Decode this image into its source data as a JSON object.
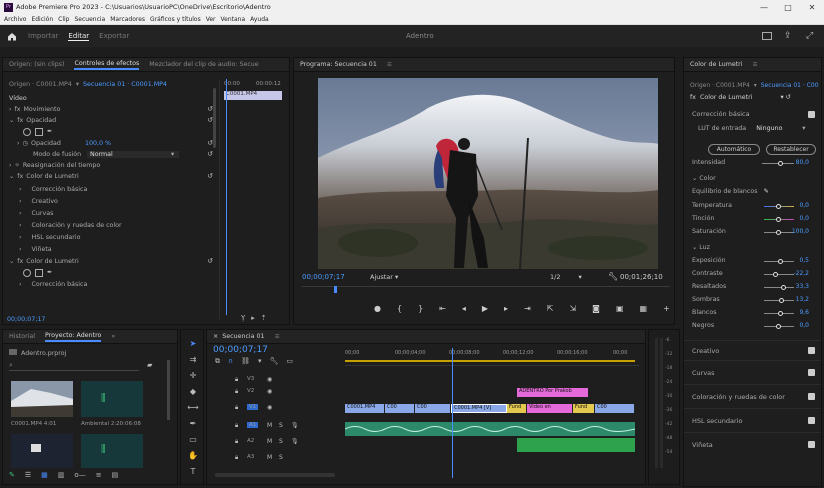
{
  "window": {
    "title": "Adobe Premiere Pro 2023 - C:\\Usuarios\\UsuarioPC\\OneDrive\\Escritorio\\Adentro",
    "minimize": "—",
    "maximize": "□",
    "close": "✕"
  },
  "menu": [
    "Archivo",
    "Edición",
    "Clip",
    "Secuencia",
    "Marcadores",
    "Gráficos y títulos",
    "Ver",
    "Ventana",
    "Ayuda"
  ],
  "appbar": {
    "home_icon": "home-icon",
    "tabs": [
      "Importar",
      "Editar",
      "Exportar"
    ],
    "active_tab": "Editar",
    "project_name": "Adentro"
  },
  "left_panel": {
    "tabs": [
      "Origen: (sin clips)",
      "Controles de efectos",
      "Mezclador del clip de audio: Secue"
    ],
    "header_source": "Origen · C0001.MP4",
    "header_seq": "Secuencia 01 · C0001.MP4",
    "mini_clip": "C0001.MP4",
    "timecode_left": "00:00",
    "timecode_right": "00:00:12",
    "video_label": "Vídeo",
    "movement": "Movimiento",
    "opacity": "Opacidad",
    "opacity_prop": "Opacidad",
    "opacity_value": "100,0 %",
    "blend_mode_label": "Modo de fusión",
    "blend_mode_value": "Normal",
    "time_remap": "Reasignación del tiempo",
    "lumetri": "Color de Lumetri",
    "lumetri_items": [
      "Corrección básica",
      "Creativo",
      "Curvas",
      "Coloración y ruedas de color",
      "HSL secundario",
      "Viñeta"
    ],
    "lumetri2": "Color de Lumetri",
    "lumetri2_item": "Corrección básica",
    "footer_timecode": "00;00;07;17"
  },
  "program": {
    "tab": "Programa: Secuencia 01",
    "timecode": "00;00;07;17",
    "fit": "Ajustar",
    "resolution": "1/2",
    "duration": "00;01;26;10"
  },
  "project": {
    "tabs": [
      "Historial",
      "Proyecto: Adentro"
    ],
    "project_file": "Adentro.prproj",
    "items": [
      {
        "name": "C0001.MP4",
        "duration": "4:01"
      },
      {
        "name": "Ambiental",
        "duration": "2:20:06:08"
      }
    ]
  },
  "timeline": {
    "tab": "Secuencia 01",
    "timecode": "00;00;07;17",
    "ruler": [
      "00;00",
      "00;00;04;00",
      "00;00;08;00",
      "00;00;12;00",
      "00;00;16;00",
      "00;00"
    ],
    "graphic_clip": "ADENTRO Por Prakob",
    "clips_v1": [
      "C0001.MP4",
      "C00",
      "C00",
      "C0001.MP4 [V]",
      "Fund",
      "Video en",
      "Fund",
      "C00"
    ],
    "audio_tracks": [
      "A1",
      "A2",
      "A3"
    ],
    "video_tracks": [
      "V3",
      "V2",
      "V1"
    ],
    "db_marks": [
      "-6",
      "-12",
      "-18",
      "-24",
      "-30",
      "-36",
      "-42",
      "-48",
      "-54"
    ]
  },
  "lumetri_panel": {
    "title": "Color de Lumetri",
    "source": "Origen · C0001.MP4",
    "seq": "Secuencia 01 · C00",
    "fx_name": "Color de Lumetri",
    "basic": "Corrección básica",
    "lut_label": "LUT de entrada",
    "lut_value": "Ninguno",
    "auto_btn": "Automático",
    "reset_btn": "Restablecer",
    "intensity_label": "Intensidad",
    "intensity_value": "80,0",
    "color_section": "Color",
    "wb_label": "Equilibrio de blancos",
    "color_sliders": [
      {
        "label": "Temperatura",
        "value": "0,0"
      },
      {
        "label": "Tinción",
        "value": "0,0"
      },
      {
        "label": "Saturación",
        "value": "100,0"
      }
    ],
    "light_section": "Luz",
    "light_sliders": [
      {
        "label": "Exposición",
        "value": "0,5"
      },
      {
        "label": "Contraste",
        "value": "-22,2"
      },
      {
        "label": "Resaltados",
        "value": "33,3"
      },
      {
        "label": "Sombras",
        "value": "13,2"
      },
      {
        "label": "Blancos",
        "value": "9,6"
      },
      {
        "label": "Negros",
        "value": "0,0"
      }
    ],
    "sections": [
      "Creativo",
      "Curvas",
      "Coloración y ruedas de color",
      "HSL secundario",
      "Viñeta"
    ]
  }
}
